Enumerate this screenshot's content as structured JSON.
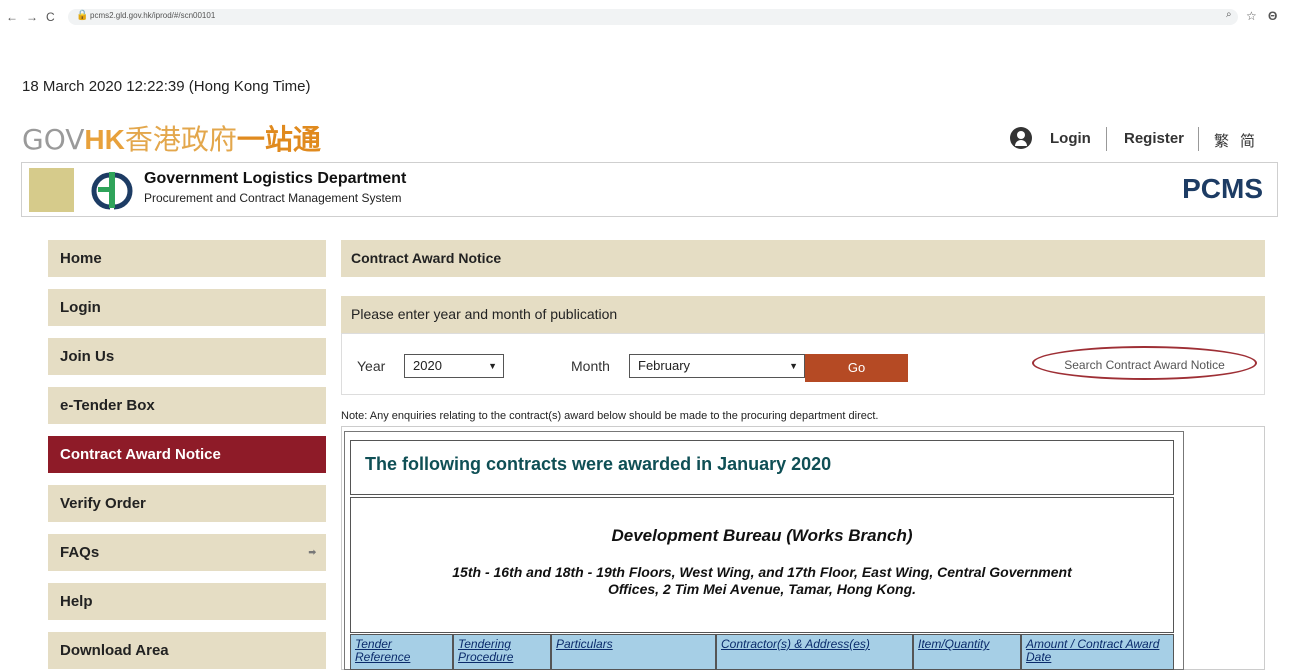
{
  "browser": {
    "back": "←",
    "forward": "→",
    "reload": "C",
    "url": "pcms2.gld.gov.hk/iprod/#/scn00101",
    "zoom_icon": "🔍",
    "star_icon": "☆",
    "profile_icon": "Θ"
  },
  "timestamp": "18 March 2020 12:22:39 (Hong Kong Time)",
  "brand": {
    "gov": "GOV",
    "hk": "HK",
    "zh": "香港政府",
    "yizhan": "一站通"
  },
  "account": {
    "login": "Login",
    "register": "Register",
    "trad": "繁",
    "simp": "简"
  },
  "banner": {
    "dept": "Government Logistics Department",
    "system": "Procurement and Contract Management System",
    "pcms": "PCMS"
  },
  "sidebar": {
    "items": [
      {
        "label": "Home"
      },
      {
        "label": "Login"
      },
      {
        "label": "Join Us"
      },
      {
        "label": "e-Tender Box"
      },
      {
        "label": "Contract Award Notice"
      },
      {
        "label": "Verify Order"
      },
      {
        "label": "FAQs"
      },
      {
        "label": "Help"
      },
      {
        "label": "Download Area"
      }
    ],
    "faq_arrow": "➡"
  },
  "main": {
    "title": "Contract Award Notice",
    "prompt": "Please enter year and month of publication",
    "year_label": "Year",
    "year_value": "2020",
    "month_label": "Month",
    "month_value": "February",
    "go": "Go",
    "search_link": "Search Contract Award Notice",
    "note": "Note: Any enquiries relating to the contract(s) award below should be made to the procuring department direct.",
    "awarded_heading": "The following contracts were awarded in January 2020",
    "department": "Development Bureau (Works Branch)",
    "address": "15th - 16th and 18th - 19th Floors, West Wing, and 17th Floor, East Wing, Central Government Offices, 2 Tim Mei Avenue, Tamar, Hong Kong.",
    "columns": [
      "Tender Reference",
      "Tendering Procedure",
      "Particulars",
      "Contractor(s) & Address(es)",
      "Item/Quantity",
      "Amount / Contract Award Date"
    ]
  },
  "colors": {
    "accent_active": "#8e1b28",
    "menu_bg": "#e5ddc4",
    "go_button": "#b54a24",
    "table_header": "#a6cfe6"
  }
}
